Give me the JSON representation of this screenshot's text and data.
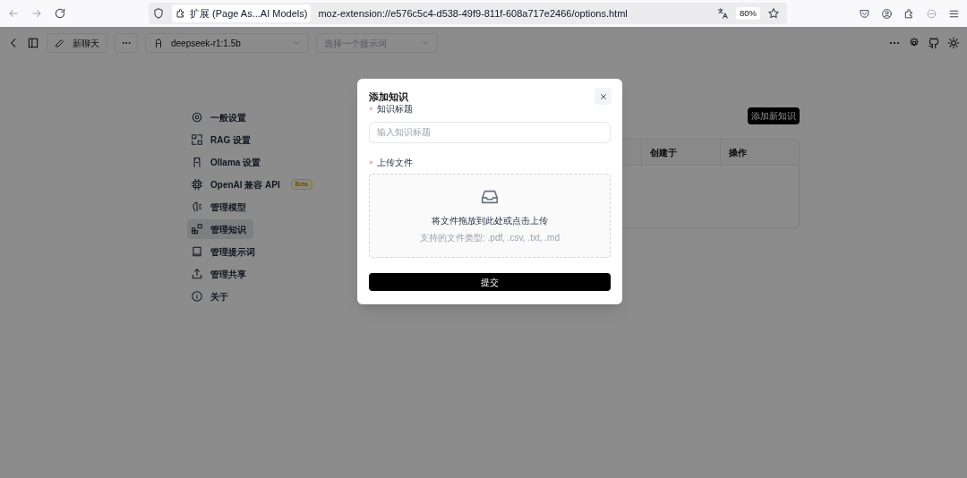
{
  "browser": {
    "site_label": "扩展 (Page As...AI Models)",
    "url": "moz-extension://e576c5c4-d538-49f9-811f-608a717e2466/options.html",
    "zoom": "80%"
  },
  "toolbar": {
    "new_chat": "新聊天",
    "model": "deepseek-r1:1.5b",
    "prompt_placeholder": "选择一个提示词"
  },
  "sidebar": {
    "items": [
      {
        "label": "一般设置",
        "selected": false
      },
      {
        "label": "RAG 设置",
        "selected": false
      },
      {
        "label": "Ollama 设置",
        "selected": false
      },
      {
        "label": "OpenAI 兼容 API",
        "selected": false,
        "badge": "Beta"
      },
      {
        "label": "管理模型",
        "selected": false
      },
      {
        "label": "管理知识",
        "selected": true
      },
      {
        "label": "管理提示词",
        "selected": false
      },
      {
        "label": "管理共享",
        "selected": false
      },
      {
        "label": "关于",
        "selected": false
      }
    ]
  },
  "content": {
    "add_button": "添加新知识",
    "table": {
      "columns": [
        "创建于",
        "操作"
      ]
    }
  },
  "modal": {
    "title": "添加知识",
    "fields": [
      {
        "label": "知识标题",
        "required": true,
        "placeholder": "输入知识标题"
      },
      {
        "label": "上传文件",
        "required": true
      }
    ],
    "upload": {
      "text": "将文件拖放到此处或点击上传",
      "hint": "支持的文件类型: .pdf, .csv, .txt, .md"
    },
    "submit": "提交"
  }
}
